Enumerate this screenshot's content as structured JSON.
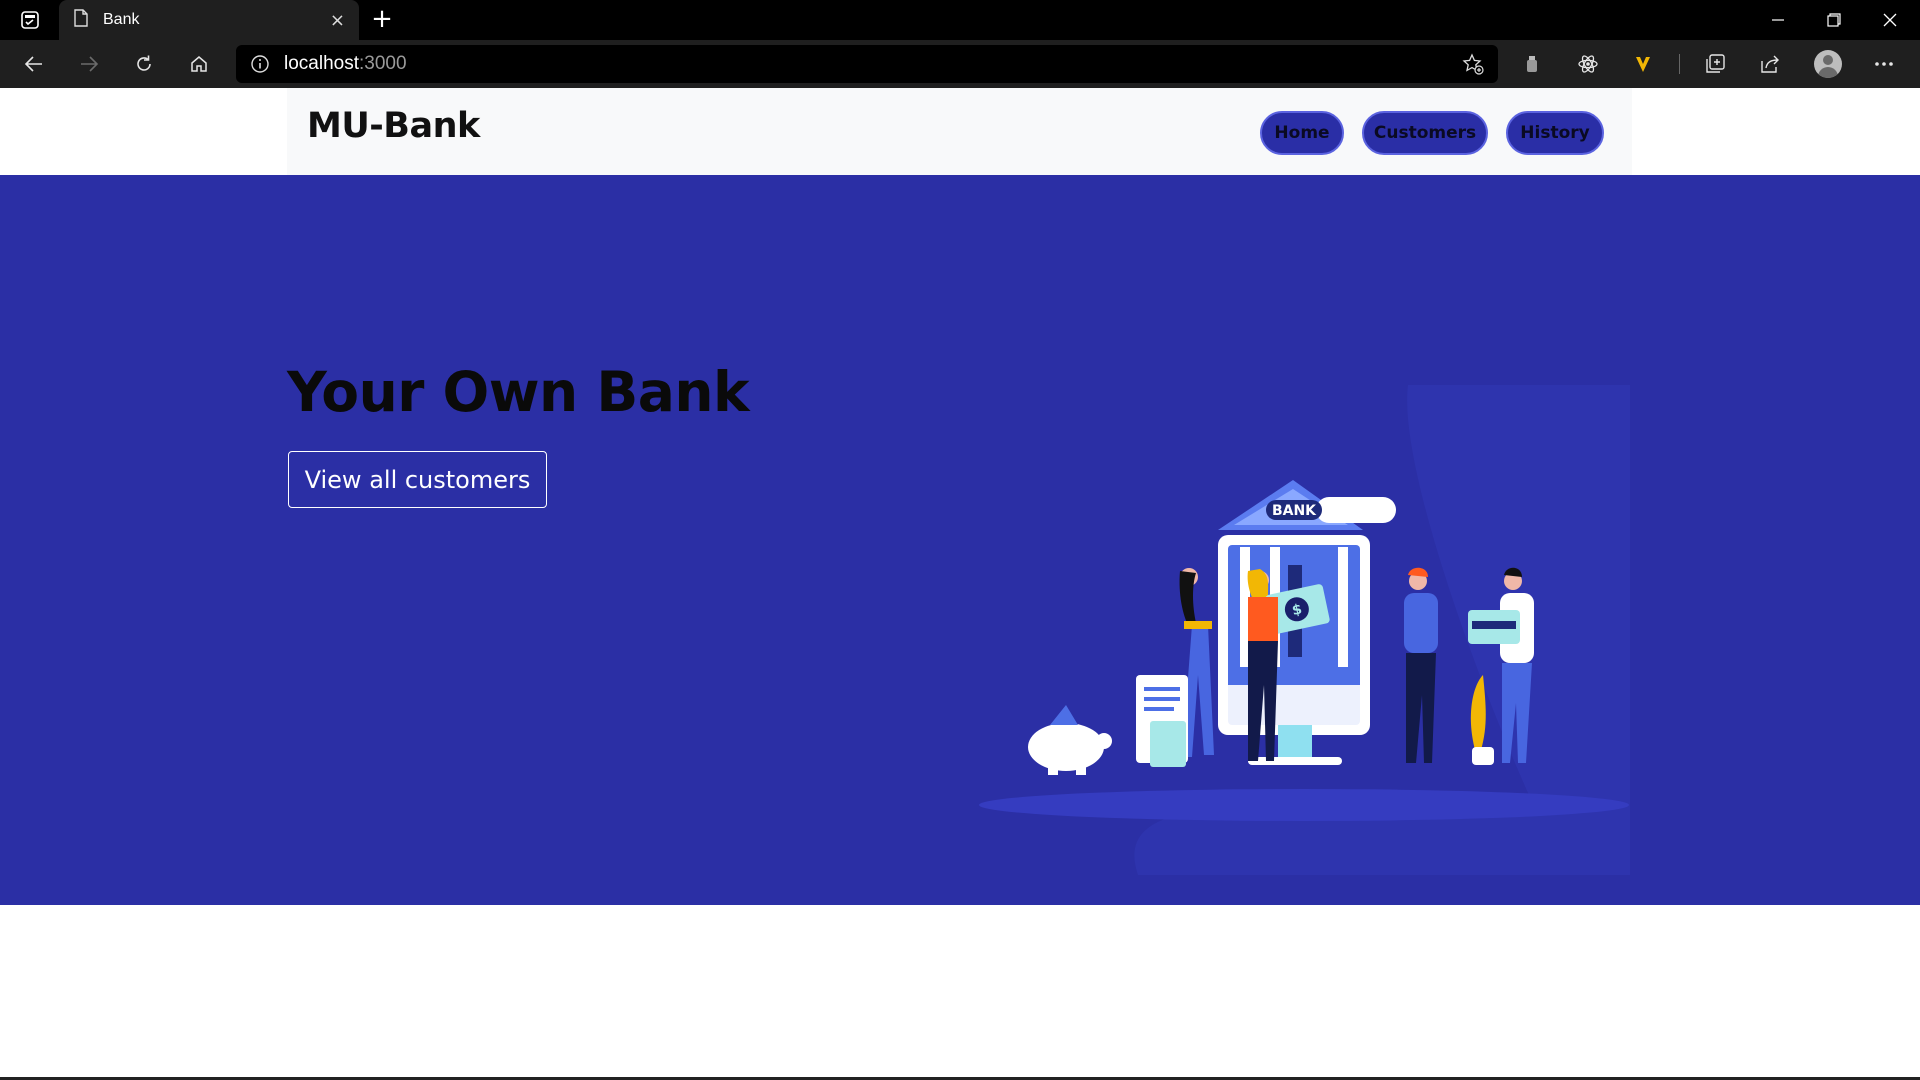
{
  "browser": {
    "tab_title": "Bank",
    "tab_close": "×",
    "new_tab": "+",
    "url_host": "localhost",
    "url_port": ":3000"
  },
  "navbar": {
    "brand": "MU-Bank",
    "links": [
      "Home",
      "Customers",
      "History"
    ]
  },
  "hero": {
    "title": "Your Own Bank",
    "cta": "View all customers",
    "illustration_sign": "BANK"
  },
  "colors": {
    "hero_bg": "#2b2fa5",
    "nav_button_bg": "#2a2ea6",
    "navbar_bg": "#f8f9fa",
    "chrome_bg": "#1f1f1f"
  }
}
